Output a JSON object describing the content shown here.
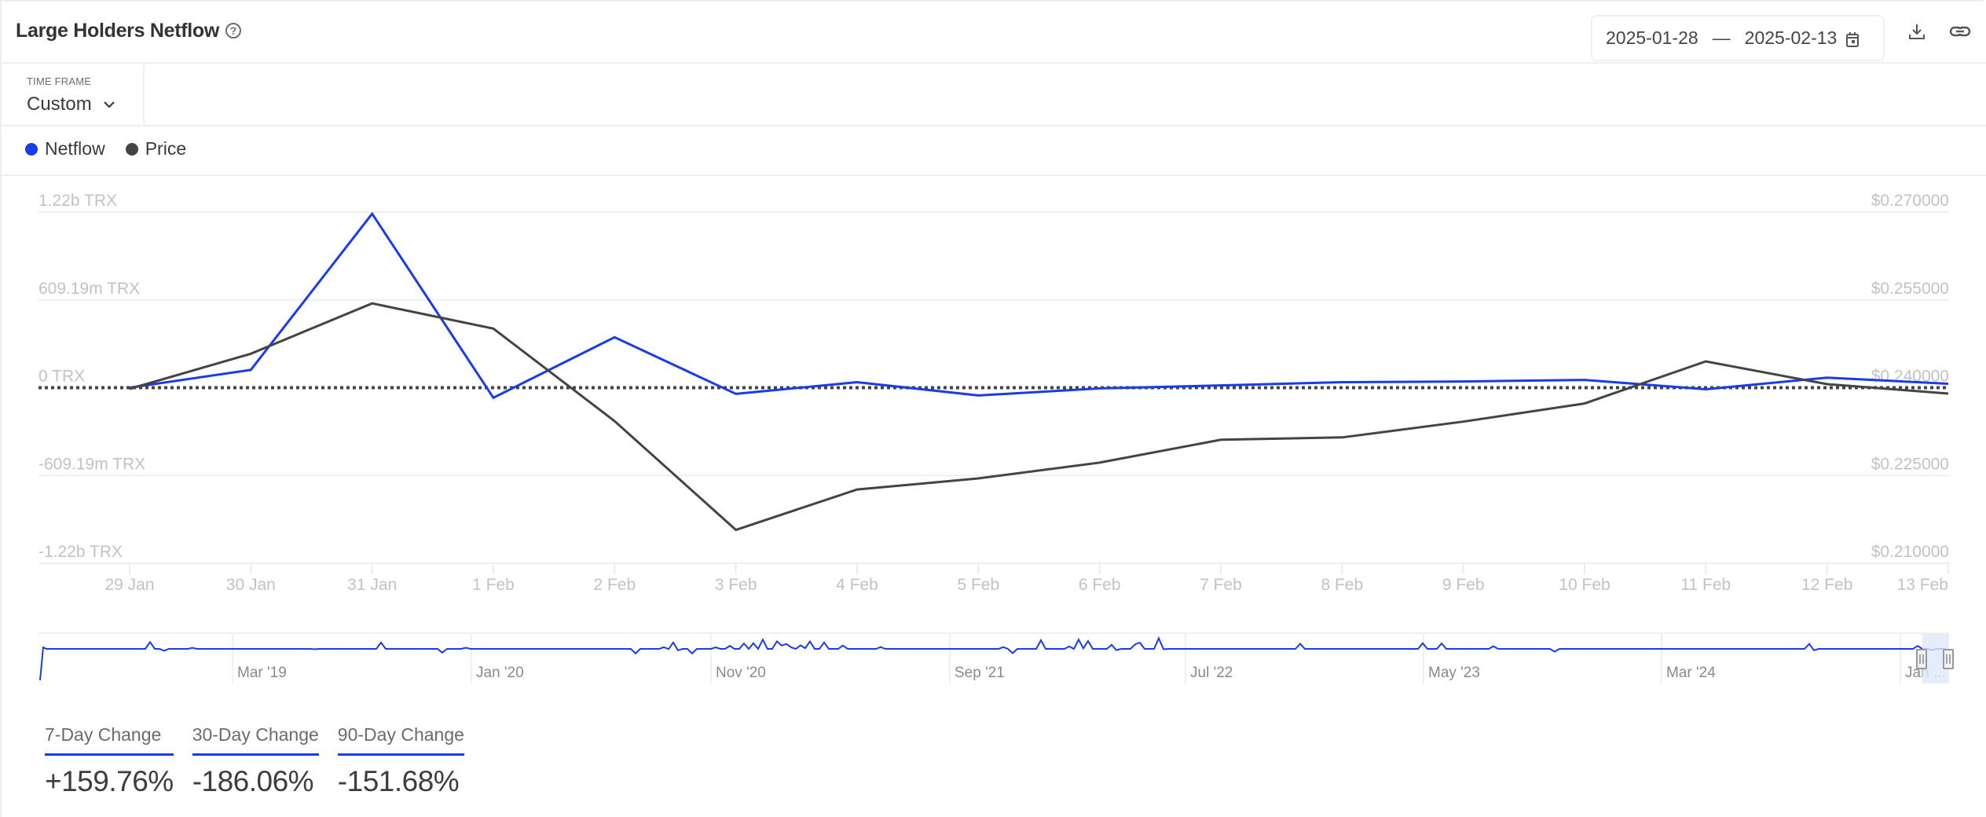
{
  "header": {
    "title": "Large Holders Netflow",
    "help_icon": "question-circle-icon",
    "date_range": {
      "start": "2025-01-28",
      "separator": "—",
      "end": "2025-02-13",
      "icon": "calendar-icon"
    },
    "actions": [
      {
        "name": "download",
        "icon": "download-icon"
      },
      {
        "name": "copy-link",
        "icon": "link-icon"
      }
    ]
  },
  "timeframe": {
    "label": "TIME FRAME",
    "selected": "Custom"
  },
  "legend": [
    {
      "label": "Netflow",
      "color": "#1a3ce8"
    },
    {
      "label": "Price",
      "color": "#444444"
    }
  ],
  "chart_data": {
    "type": "line",
    "title": "Large Holders Netflow",
    "categories": [
      "29 Jan",
      "30 Jan",
      "31 Jan",
      "1 Feb",
      "2 Feb",
      "3 Feb",
      "4 Feb",
      "5 Feb",
      "6 Feb",
      "7 Feb",
      "8 Feb",
      "9 Feb",
      "10 Feb",
      "11 Feb",
      "12 Feb",
      "13 Feb"
    ],
    "series": [
      {
        "name": "Netflow",
        "axis": "left",
        "color": "#1a3ce8",
        "unit": "TRX",
        "values": [
          0,
          124000000,
          1207000000,
          -70000000,
          350000000,
          -43000000,
          38000000,
          -54000000,
          -5000000,
          16000000,
          38000000,
          43000000,
          54000000,
          -11000000,
          70000000,
          27000000
        ]
      },
      {
        "name": "Price",
        "axis": "right",
        "color": "#444444",
        "unit": "USD",
        "values": [
          0.2398,
          0.2458,
          0.2544,
          0.2501,
          0.2343,
          0.2157,
          0.2226,
          0.2245,
          0.2272,
          0.2311,
          0.2315,
          0.2342,
          0.2373,
          0.2445,
          0.2406,
          0.239
        ]
      }
    ],
    "y_left": {
      "ticks": [
        1218380000,
        609190000,
        0,
        -609190000,
        -1218380000
      ],
      "tick_labels": [
        "1.22b TRX",
        "609.19m TRX",
        "0 TRX",
        "-609.19m TRX",
        "-1.22b TRX"
      ],
      "range": [
        -1218380000,
        1218380000
      ]
    },
    "y_right": {
      "ticks": [
        0.27,
        0.255,
        0.24,
        0.225,
        0.21
      ],
      "tick_labels": [
        "$0.270000",
        "$0.255000",
        "$0.240000",
        "$0.225000",
        "$0.210000"
      ],
      "range": [
        0.21,
        0.27
      ]
    },
    "zero_line": "dotted",
    "grid": true,
    "legend_position": "top-left",
    "navigator": {
      "tick_labels": [
        "Mar '19",
        "Jan '20",
        "Nov '20",
        "Sep '21",
        "Jul '22",
        "May '23",
        "Mar '24",
        "Jan ..."
      ],
      "selection": "2025-01-28 to 2025-02-13"
    }
  },
  "stats": [
    {
      "label": "7-Day Change",
      "value": "+159.76%"
    },
    {
      "label": "30-Day Change",
      "value": "-186.06%"
    },
    {
      "label": "90-Day Change",
      "value": "-151.68%"
    }
  ]
}
